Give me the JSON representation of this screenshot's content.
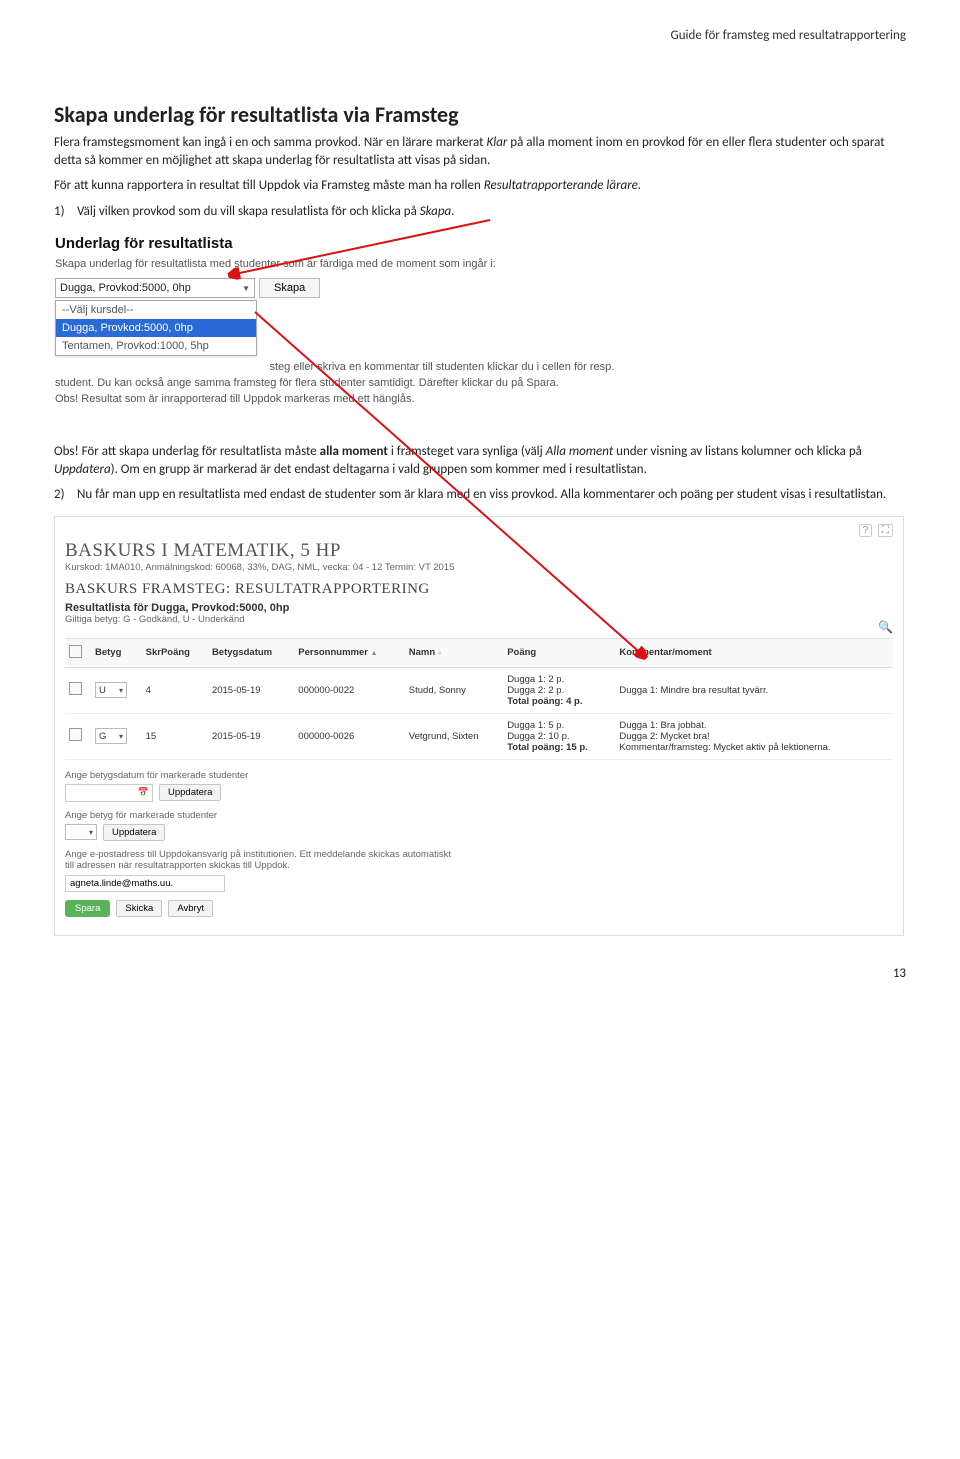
{
  "page_header": "Guide för framsteg med resultatrapportering",
  "h1": "Skapa underlag för resultatlista via Framsteg",
  "p1": "Flera framstegsmoment kan ingå i en och samma provkod. När en lärare markerat ",
  "p1_italic": "Klar",
  "p1_after": " på alla moment inom en provkod för en eller flera studenter och sparat detta så kommer en möjlighet att skapa underlag för resultatlista att visas på sidan.",
  "p2_before": "För att kunna rapportera in resultat till Uppdok via Framsteg måste man ha rollen ",
  "p2_italic": "Resultatrapporterande lärare.",
  "li1_before": "Välj vilken provkod som du vill skapa resulatlista för och klicka på ",
  "li1_italic": "Skapa.",
  "shot1": {
    "title": "Underlag för resultatlista",
    "desc": "Skapa underlag för resultatlista med studenter som är färdiga med de moment som ingår i:",
    "sel_value": "Dugga, Provkod:5000, 0hp",
    "btn_skapa": "Skapa",
    "dd_placeholder": "--Välj kursdel--",
    "dd_selected": "Dugga, Provkod:5000, 0hp",
    "dd_item2": "Tentamen, Provkod:1000, 5hp",
    "body_l2": "steg eller skriva en kommentar till studenten klickar du i cellen för resp.",
    "body_l3": "student. Du kan också ange samma framsteg för flera studenter samtidigt. Därefter klickar du på Spara.",
    "body_l4": "Obs! Resultat som är inrapporterad till Uppdok markeras med ett hänglås."
  },
  "obs_prefix": "Obs! För att skapa underlag för resultatlista måste ",
  "obs_bold": "alla moment",
  "obs_mid": " i framsteget vara synliga (välj ",
  "obs_italic1": "Alla moment",
  "obs_mid2": " under visning av listans kolumner och klicka på ",
  "obs_italic2": "Uppdatera",
  "obs_after": "). Om en grupp är markerad är det endast deltagarna i vald gruppen som kommer med i resultatlistan.",
  "li2": "Nu får man upp en resultatlista med endast de studenter som är klara med en viss provkod. Alla kommentarer och poäng per student visas i resultatlistan.",
  "shot2": {
    "course_title": "BASKURS I MATEMATIK, 5 HP",
    "course_sub": "Kurskod: 1MA010, Anmälningskod: 60068, 33%, DAG, NML, vecka: 04 - 12 Termin: VT 2015",
    "section_title": "BASKURS FRAMSTEG: RESULTATRAPPORTERING",
    "list_title": "Resultatlista för Dugga, Provkod:5000, 0hp",
    "list_sub": "Giltiga betyg: G - Godkänd, U - Underkänd",
    "cols": {
      "betyg": "Betyg",
      "skrpoang": "SkrPoäng",
      "betygsdatum": "Betygsdatum",
      "pnr": "Personnummer",
      "namn": "Namn",
      "poang": "Poäng",
      "kommentar": "Kommentar/moment"
    },
    "rows": [
      {
        "betyg": "U",
        "skrpoang": "4",
        "datum": "2015-05-19",
        "pnr": "000000-0022",
        "namn": "Studd, Sonny",
        "poang_l1": "Dugga 1: 2 p.",
        "poang_l2": "Dugga 2: 2 p.",
        "poang_tot": "Total poäng: 4 p.",
        "komm_l1": "Dugga 1: Mindre bra resultat tyvärr.",
        "komm_l2": "",
        "komm_l3": ""
      },
      {
        "betyg": "G",
        "skrpoang": "15",
        "datum": "2015-05-19",
        "pnr": "000000-0026",
        "namn": "Vetgrund, Sixten",
        "poang_l1": "Dugga 1: 5 p.",
        "poang_l2": "Dugga 2: 10 p.",
        "poang_tot": "Total poäng: 15 p.",
        "komm_l1": "Dugga 1: Bra jobbat.",
        "komm_l2": "Dugga 2: Mycket bra!",
        "komm_l3": "Kommentar/framsteg: Mycket aktiv på lektionerna."
      }
    ],
    "footer": {
      "date_lbl": "Ange betygsdatum för markerade studenter",
      "grade_lbl": "Ange betyg för markerade studenter",
      "update_btn": "Uppdatera",
      "email_txt_l1": "Ange e-postadress till Uppdokansvarig på institutionen. Ett meddelande skickas automatiskt",
      "email_txt_l2": "till adressen när resultatrapporten skickas till Uppdok.",
      "email_val": "agneta.linde@maths.uu.",
      "btn_spara": "Spara",
      "btn_skicka": "Skicka",
      "btn_avbryt": "Avbryt"
    }
  },
  "page_number": "13"
}
